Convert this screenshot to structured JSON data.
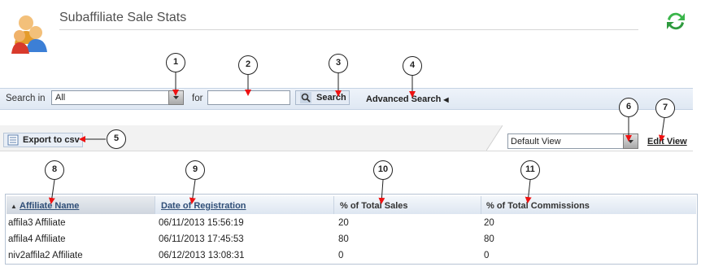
{
  "header": {
    "title": "Subaffiliate Sale Stats",
    "logo_icon": "affiliates-icon",
    "refresh_icon": "refresh-icon"
  },
  "search": {
    "label": "Search in",
    "scope_value": "All",
    "for_label": "for",
    "query_value": "",
    "button_label": "Search",
    "advanced_label": "Advanced Search"
  },
  "toolbar": {
    "export_label": "Export to csv",
    "view_value": "Default View",
    "edit_view_label": "Edit View"
  },
  "table": {
    "columns": [
      "Affiliate Name",
      "Date of Registration",
      "% of Total Sales",
      "% of Total Commissions"
    ],
    "rows": [
      [
        "affila3 Affiliate",
        "06/11/2013 15:56:19",
        "20",
        "20"
      ],
      [
        "affila4 Affiliate",
        "06/11/2013 17:45:53",
        "80",
        "80"
      ],
      [
        "niv2affila2 Affiliate",
        "06/12/2013 13:08:31",
        "0",
        "0"
      ]
    ]
  },
  "callouts": [
    "1",
    "2",
    "3",
    "4",
    "5",
    "6",
    "7",
    "8",
    "9",
    "10",
    "11"
  ],
  "colors": {
    "accent_blue": "#2f4e77",
    "arrow_red": "#ee1111",
    "refresh_green": "#3ab54a"
  }
}
